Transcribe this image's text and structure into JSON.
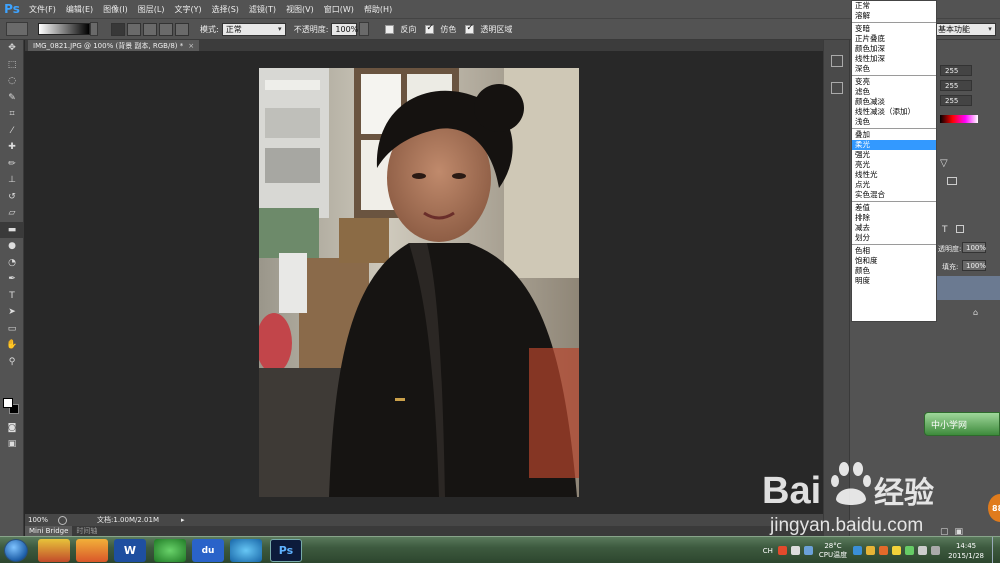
{
  "app": {
    "logo": "Ps"
  },
  "menu": [
    "文件(F)",
    "编辑(E)",
    "图像(I)",
    "图层(L)",
    "文字(Y)",
    "选择(S)",
    "滤镜(T)",
    "视图(V)",
    "窗口(W)",
    "帮助(H)"
  ],
  "options": {
    "mode_label": "模式:",
    "mode_value": "正常",
    "opacity_label": "不透明度:",
    "opacity_value": "100%",
    "reverse_label": "反向",
    "dither_label": "仿色",
    "transparency_label": "透明区域",
    "workspace_value": "基本功能"
  },
  "document": {
    "tab_title": "IMG_0821.JPG @ 100% (背景 副本, RGB/8) *",
    "zoom": "100%",
    "doc_info": "文档:1.00M/2.01M"
  },
  "bottom_tabs": {
    "mini_bridge": "Mini Bridge",
    "timeline": "时间轴"
  },
  "panels": {
    "rgb_values": [
      "255",
      "255",
      "255"
    ],
    "opacity_label": "透明度:",
    "opacity_value": "100%",
    "fill_label": "填充:",
    "fill_value": "100%"
  },
  "blend_menu": {
    "groups": [
      [
        "正常",
        "溶解"
      ],
      [
        "变暗",
        "正片叠底",
        "颜色加深",
        "线性加深",
        "深色"
      ],
      [
        "变亮",
        "滤色",
        "颜色减淡",
        "线性减淡（添加）",
        "浅色"
      ],
      [
        "叠加",
        "柔光",
        "强光",
        "亮光",
        "线性光",
        "点光",
        "实色混合"
      ],
      [
        "差值",
        "排除",
        "减去",
        "划分"
      ],
      [
        "色相",
        "饱和度",
        "颜色",
        "明度"
      ]
    ],
    "selected": "柔光"
  },
  "overlay": {
    "badge_text": "中小学网",
    "watermark_brand": "Bai",
    "watermark_brand2": "经验",
    "watermark_url": "jingyan.baidu.com",
    "corner_badge": "88"
  },
  "taskbar": {
    "apps": [
      "W",
      "du",
      "Ps"
    ],
    "tray_text": "CH",
    "weather": "28°C",
    "cpu_label": "CPU温度",
    "time": "14:45",
    "date": "2015/1/28"
  },
  "colors": {
    "selected_item": "#3399ff",
    "ps_blue": "#3ea3ff",
    "panel": "#535353"
  }
}
